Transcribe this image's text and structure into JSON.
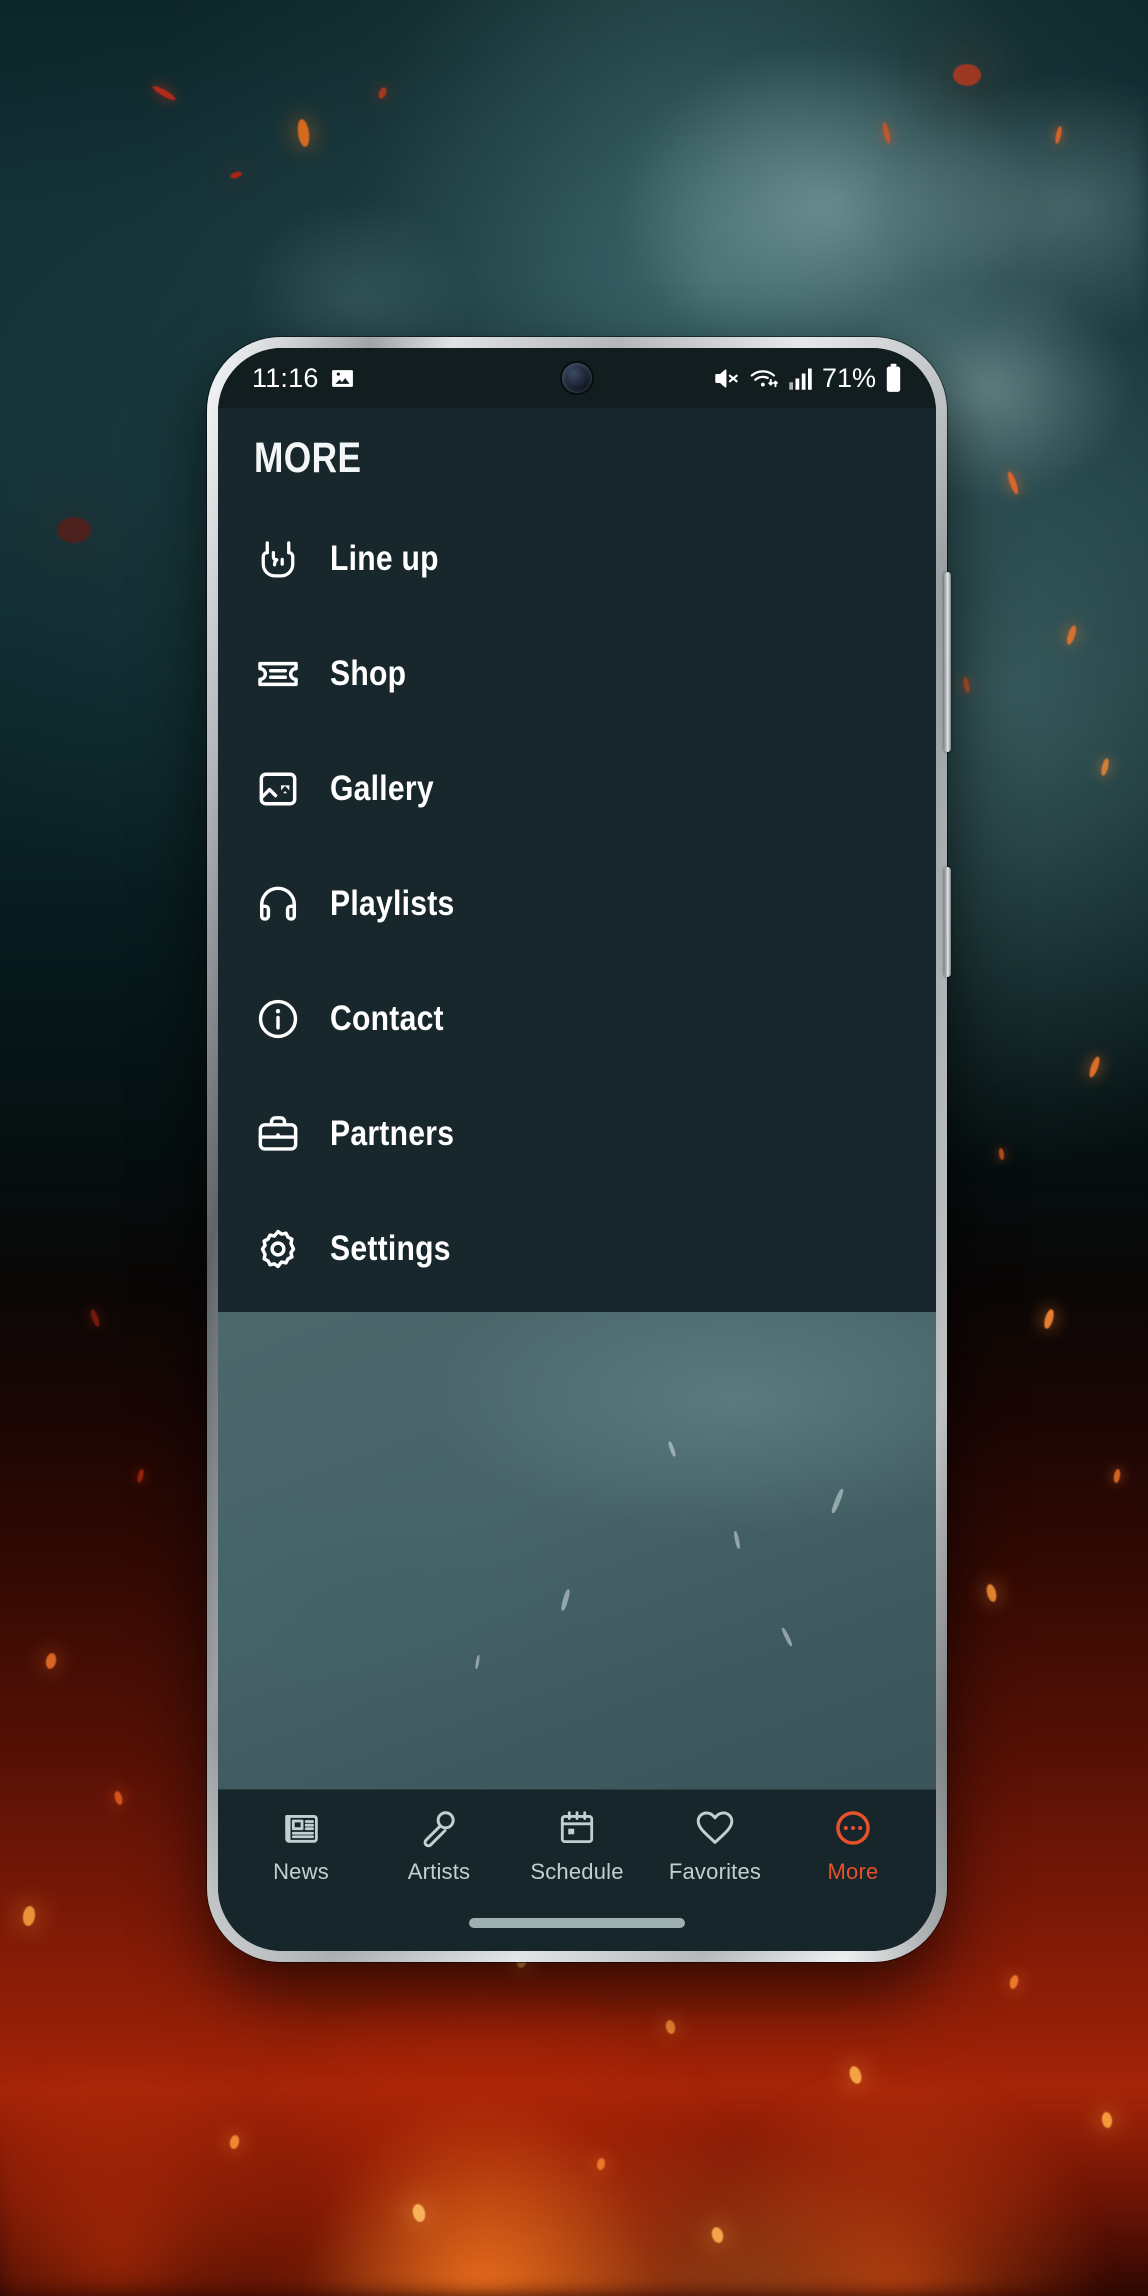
{
  "status_bar": {
    "clock": "11:16",
    "battery_percent": "71%",
    "icons": [
      "image-notification-icon",
      "mute-icon",
      "wifi-icon",
      "cellular-signal-icon",
      "battery-icon"
    ],
    "camera": "front-camera-punch-hole"
  },
  "header": {
    "title": "MORE"
  },
  "menu": {
    "items": [
      {
        "label": "Line up",
        "icon": "rock-hand-icon"
      },
      {
        "label": "Shop",
        "icon": "ticket-icon"
      },
      {
        "label": "Gallery",
        "icon": "image-icon"
      },
      {
        "label": "Playlists",
        "icon": "headphones-icon"
      },
      {
        "label": "Contact",
        "icon": "info-circle-icon"
      },
      {
        "label": "Partners",
        "icon": "briefcase-icon"
      },
      {
        "label": "Settings",
        "icon": "gear-icon"
      }
    ]
  },
  "bottom_nav": {
    "items": [
      {
        "label": "News",
        "icon": "newspaper-icon",
        "active": false
      },
      {
        "label": "Artists",
        "icon": "microphone-icon",
        "active": false
      },
      {
        "label": "Schedule",
        "icon": "calendar-icon",
        "active": false
      },
      {
        "label": "Favorites",
        "icon": "heart-icon",
        "active": false
      },
      {
        "label": "More",
        "icon": "ellipsis-circle-icon",
        "active": true
      }
    ]
  },
  "colors": {
    "accent_orange": "#e8502a",
    "panel_dark": "#18272c",
    "nav_bar": "#16262a",
    "status_bar": "#111d1f",
    "content_teal": "#47646a",
    "label_inactive": "#c3d0d2"
  },
  "device": {
    "home_indicator": "gesture-home-indicator",
    "side_buttons": [
      "volume-rocker",
      "power-button"
    ]
  }
}
